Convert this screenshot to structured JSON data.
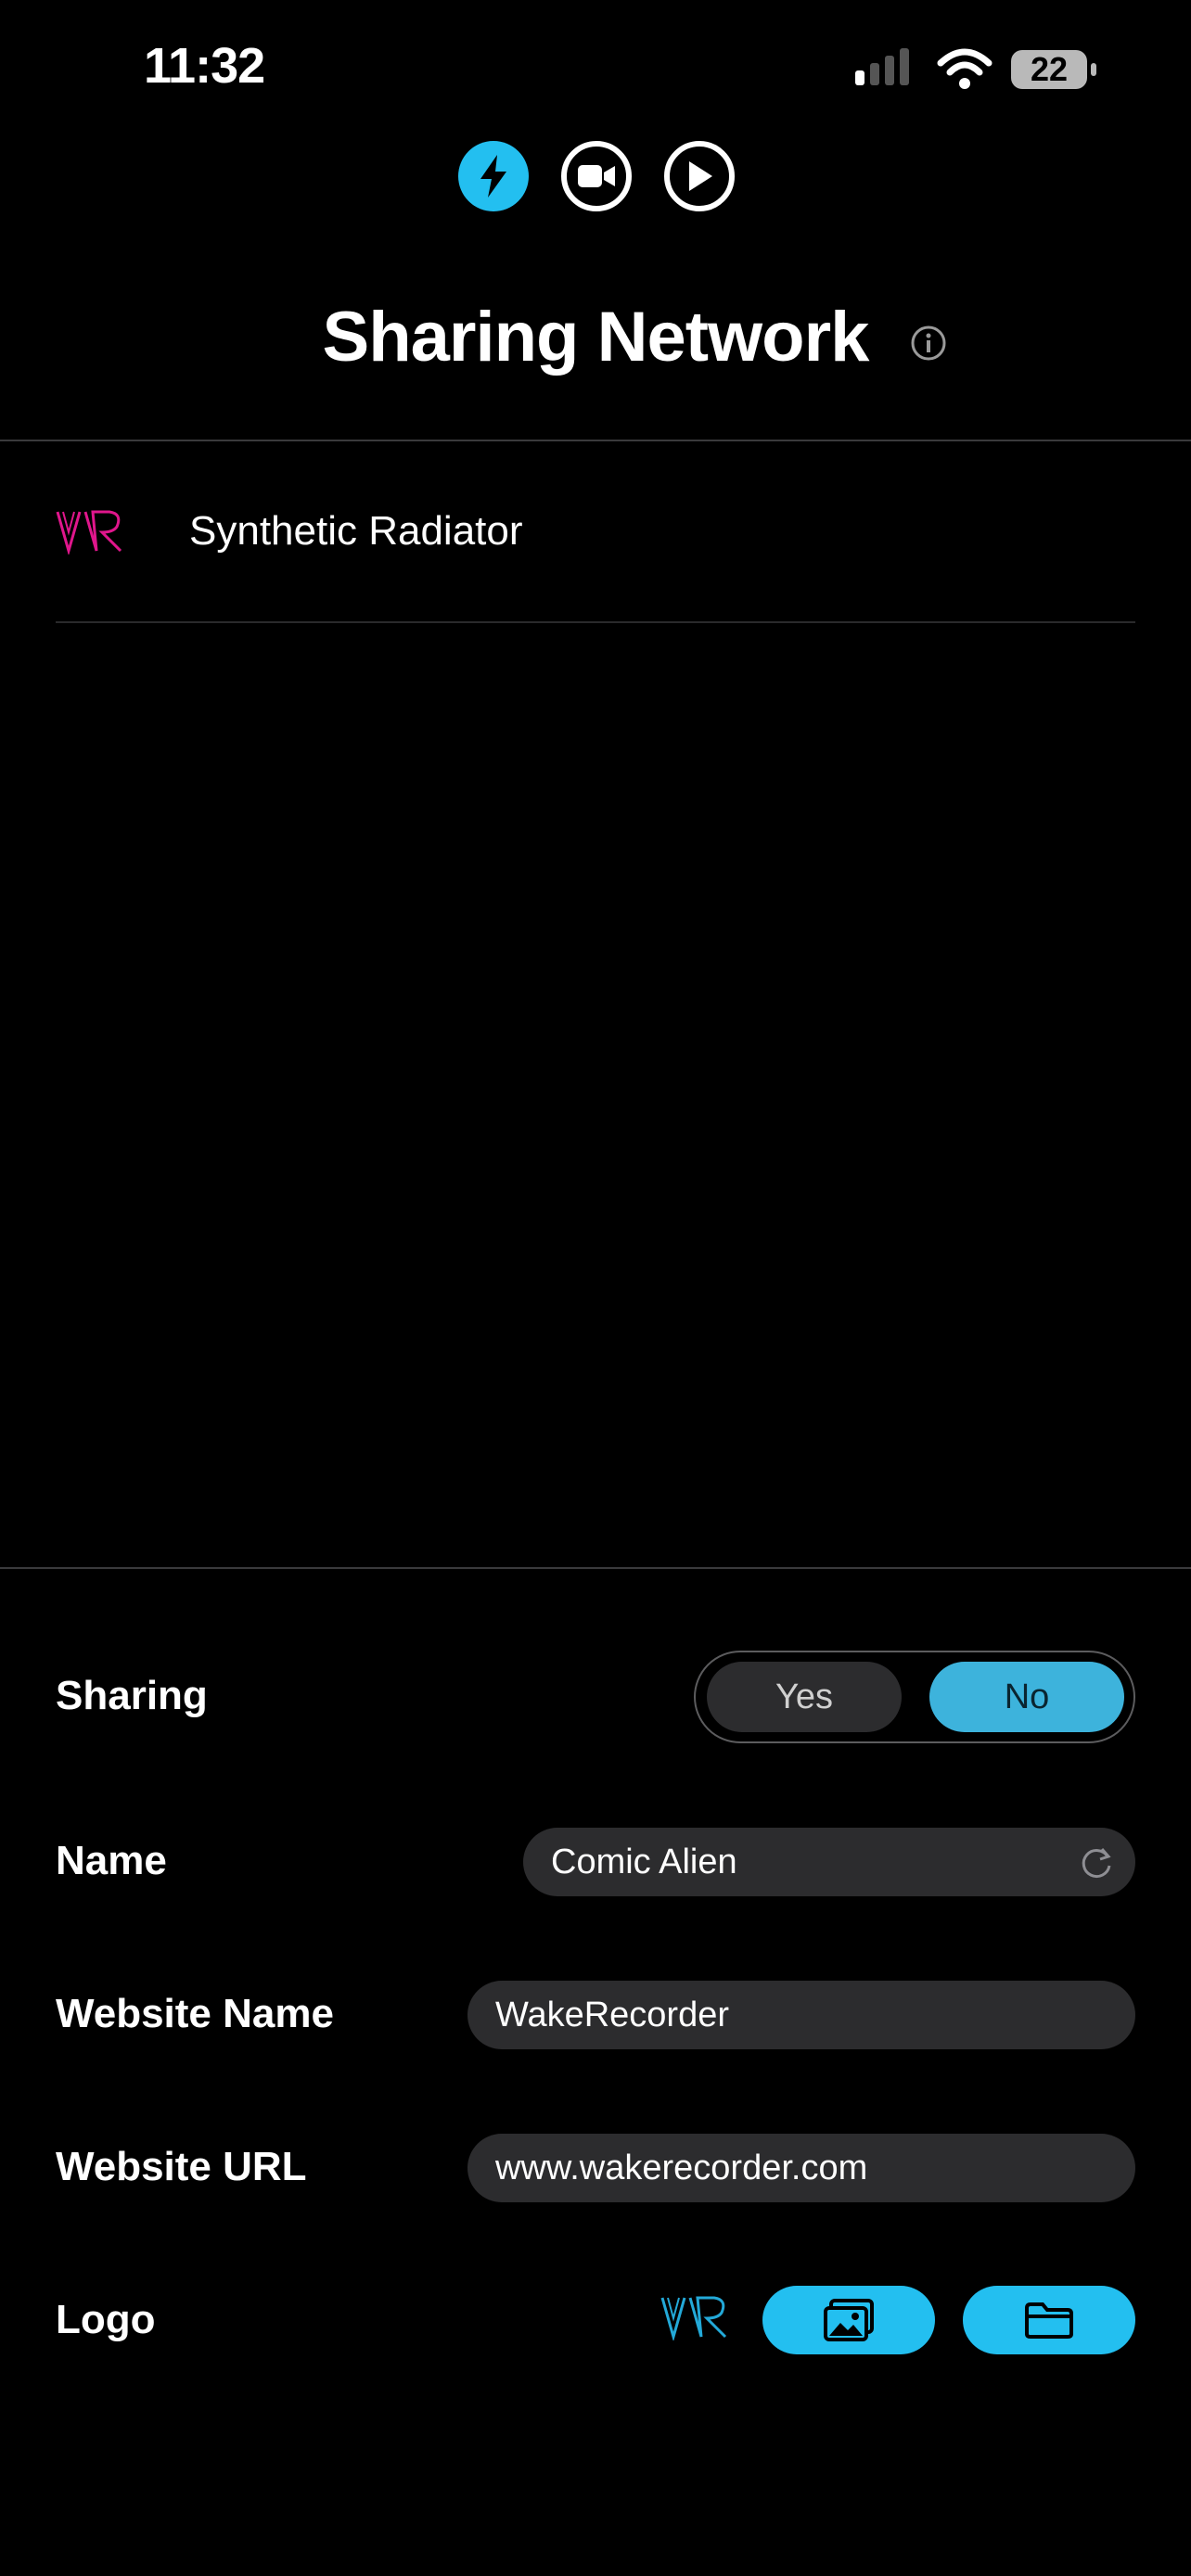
{
  "status_bar": {
    "time": "11:32",
    "battery": "22"
  },
  "modes": [
    {
      "name": "lightning-icon",
      "active": true
    },
    {
      "name": "video-camera-icon",
      "active": false
    },
    {
      "name": "play-icon",
      "active": false
    }
  ],
  "header": {
    "title": "Sharing Network"
  },
  "list": {
    "items": [
      {
        "label": "Synthetic Radiator",
        "logo_text": "VR",
        "logo_color": "#e0168c"
      }
    ]
  },
  "settings": {
    "sharing": {
      "label": "Sharing",
      "options": [
        "Yes",
        "No"
      ],
      "selected": "No"
    },
    "name": {
      "label": "Name",
      "value": "Comic Alien"
    },
    "website_name": {
      "label": "Website Name",
      "value": "WakeRecorder"
    },
    "website_url": {
      "label": "Website URL",
      "value": "www.wakerecorder.com"
    },
    "logo": {
      "label": "Logo",
      "logo_text": "VR",
      "logo_color": "#23a9d8"
    }
  },
  "colors": {
    "accent": "#23bff0",
    "background": "#000000",
    "field_bg": "#2c2c2e"
  }
}
